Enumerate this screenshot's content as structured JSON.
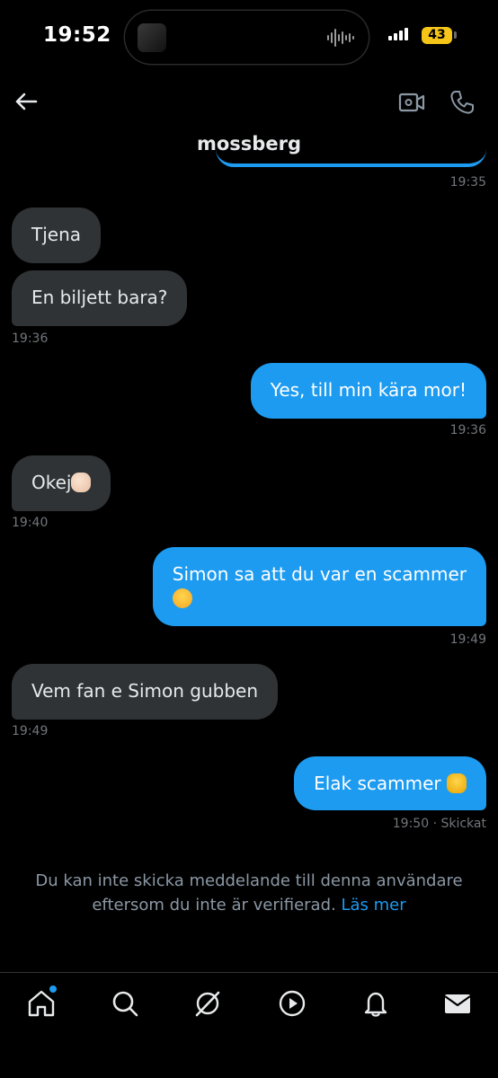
{
  "status_bar": {
    "time": "19:52",
    "battery": "43"
  },
  "header": {
    "title": "mossberg"
  },
  "messages": [
    {
      "dir": "in",
      "text": "Tjena"
    },
    {
      "dir": "in",
      "text": "En biljett bara?",
      "time": "19:36"
    },
    {
      "dir": "out",
      "text": "Yes, till min kära mor!",
      "time": "19:36"
    },
    {
      "dir": "in",
      "text": "Okej",
      "emoji": "thumbs-up-emoji",
      "time": "19:40"
    },
    {
      "dir": "out",
      "text_line1": "Simon sa att du var en scammer",
      "emoji": "crying-face-emoji",
      "time": "19:49"
    },
    {
      "dir": "in",
      "text": "Vem fan e Simon gubben",
      "time": "19:49"
    },
    {
      "dir": "out",
      "text": "Elak scammer",
      "emoji": "oncoming-fist-emoji",
      "time": "19:50",
      "status": "· Skickat"
    }
  ],
  "prev_time": "19:35",
  "notice": {
    "text": "Du kan inte skicka meddelande till denna användare eftersom du inte är verifierad.",
    "link": "Läs mer"
  },
  "tabs": [
    "home-icon",
    "search-icon",
    "grok-icon",
    "video-icon",
    "notifications-icon",
    "messages-icon"
  ]
}
